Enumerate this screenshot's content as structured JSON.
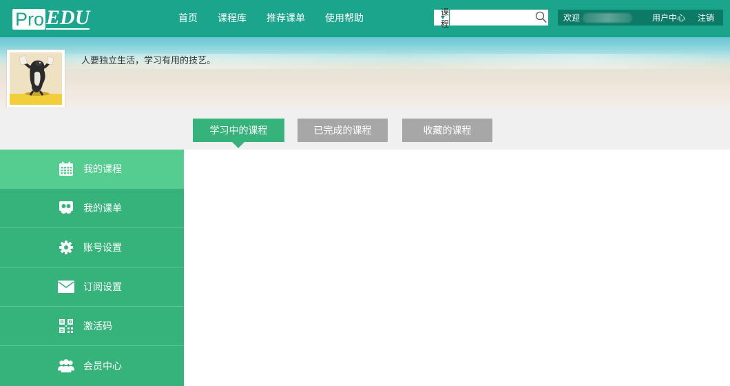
{
  "logo": {
    "part1": "Pro",
    "part2": "EDU"
  },
  "nav": [
    {
      "label": "首页"
    },
    {
      "label": "课程库"
    },
    {
      "label": "推荐课单"
    },
    {
      "label": "使用帮助"
    }
  ],
  "search": {
    "type_label": "课程",
    "value": "",
    "placeholder": ""
  },
  "user": {
    "welcome": "欢迎",
    "center_label": "用户中心",
    "logout_label": "注销"
  },
  "profile": {
    "motto": "人要独立生活，学习有用的技艺。"
  },
  "tabs": [
    {
      "label": "学习中的课程",
      "active": true
    },
    {
      "label": "已完成的课程",
      "active": false
    },
    {
      "label": "收藏的课程",
      "active": false
    }
  ],
  "sidebar": {
    "items": [
      {
        "label": "我的课程",
        "icon": "calendar-icon",
        "active": true
      },
      {
        "label": "我的课单",
        "icon": "course-list-icon",
        "active": false
      },
      {
        "label": "账号设置",
        "icon": "gear-icon",
        "active": false
      },
      {
        "label": "订阅设置",
        "icon": "envelope-icon",
        "active": false
      },
      {
        "label": "激活码",
        "icon": "qr-code-icon",
        "active": false
      },
      {
        "label": "会员中心",
        "icon": "users-icon",
        "active": false
      }
    ]
  },
  "colors": {
    "primary": "#1aa58c",
    "sidebar": "#36b37a",
    "sidebar_active": "#55cc90",
    "tab_inactive": "#a7a7a7"
  }
}
